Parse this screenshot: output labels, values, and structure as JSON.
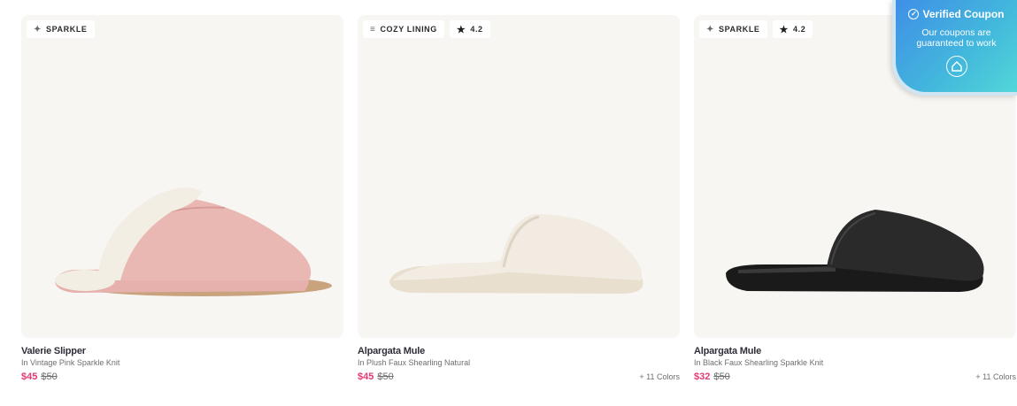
{
  "products": [
    {
      "badges": [
        {
          "icon": "sparkle-icon",
          "glyph": "✦",
          "label": "SPARKLE"
        }
      ],
      "name": "Valerie Slipper",
      "variant": "In Vintage Pink Sparkle Knit",
      "price": "$45",
      "original_price": "$50",
      "colors": ""
    },
    {
      "badges": [
        {
          "icon": "lining-icon",
          "glyph": "≡",
          "label": "COZY LINING"
        },
        {
          "icon": "star-icon",
          "glyph": "★",
          "label": "4.2"
        }
      ],
      "name": "Alpargata Mule",
      "variant": "In Plush Faux Shearling Natural",
      "price": "$45",
      "original_price": "$50",
      "colors": "+ 11 Colors"
    },
    {
      "badges": [
        {
          "icon": "sparkle-icon",
          "glyph": "✦",
          "label": "SPARKLE"
        },
        {
          "icon": "star-icon",
          "glyph": "★",
          "label": "4.2"
        }
      ],
      "name": "Alpargata Mule",
      "variant": "In Black Faux Shearling Sparkle Knit",
      "price": "$32",
      "original_price": "$50",
      "colors": "+ 11 Colors"
    }
  ],
  "coupon": {
    "title": "Verified Coupon",
    "line1": "Our coupons are",
    "line2": "guaranteed to work"
  },
  "colors": {
    "sale_price": "#e23a72",
    "card_bg": "#f7f6f3",
    "coupon_start": "#3f8fe6",
    "coupon_end": "#52d7d9"
  }
}
